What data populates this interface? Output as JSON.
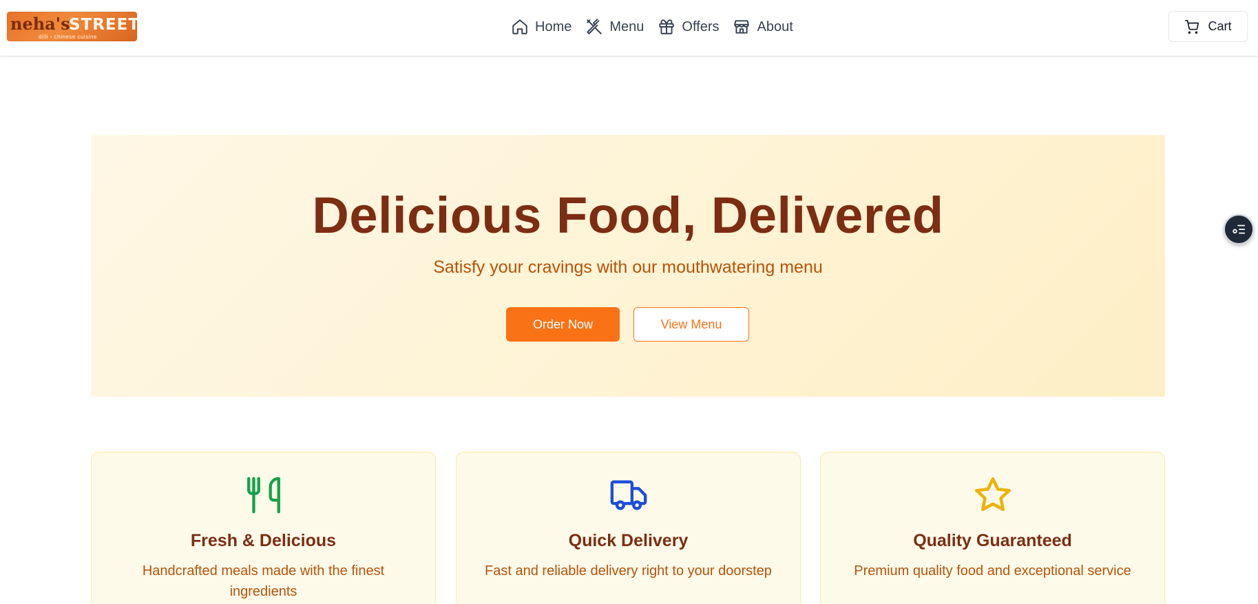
{
  "brand": {
    "logo_script": "neha's",
    "logo_main": "STREET",
    "logo_tagline": "dilli - chinese cuisine"
  },
  "nav": {
    "items": [
      {
        "label": "Home",
        "icon": "home-icon"
      },
      {
        "label": "Menu",
        "icon": "utensils-crossed-icon"
      },
      {
        "label": "Offers",
        "icon": "gift-icon"
      },
      {
        "label": "About",
        "icon": "store-icon"
      }
    ]
  },
  "cart": {
    "label": "Cart",
    "icon": "cart-icon"
  },
  "hero": {
    "title": "Delicious Food, Delivered",
    "subtitle": "Satisfy your cravings with our mouthwatering menu",
    "primary_button": "Order Now",
    "secondary_button": "View Menu"
  },
  "features": [
    {
      "icon": "utensils-icon",
      "icon_color": "#16a34a",
      "title": "Fresh & Delicious",
      "description": "Handcrafted meals made with the finest ingredients"
    },
    {
      "icon": "truck-icon",
      "icon_color": "#1d4ed8",
      "title": "Quick Delivery",
      "description": "Fast and reliable delivery right to your doorstep"
    },
    {
      "icon": "star-icon",
      "icon_color": "#eab308",
      "title": "Quality Guaranteed",
      "description": "Premium quality food and exceptional service"
    }
  ],
  "colors": {
    "accent": "#f97316",
    "heading": "#7c2d12",
    "subtext": "#b45309",
    "hero_bg": "#fef3d4",
    "card_bg": "#fefaea"
  }
}
